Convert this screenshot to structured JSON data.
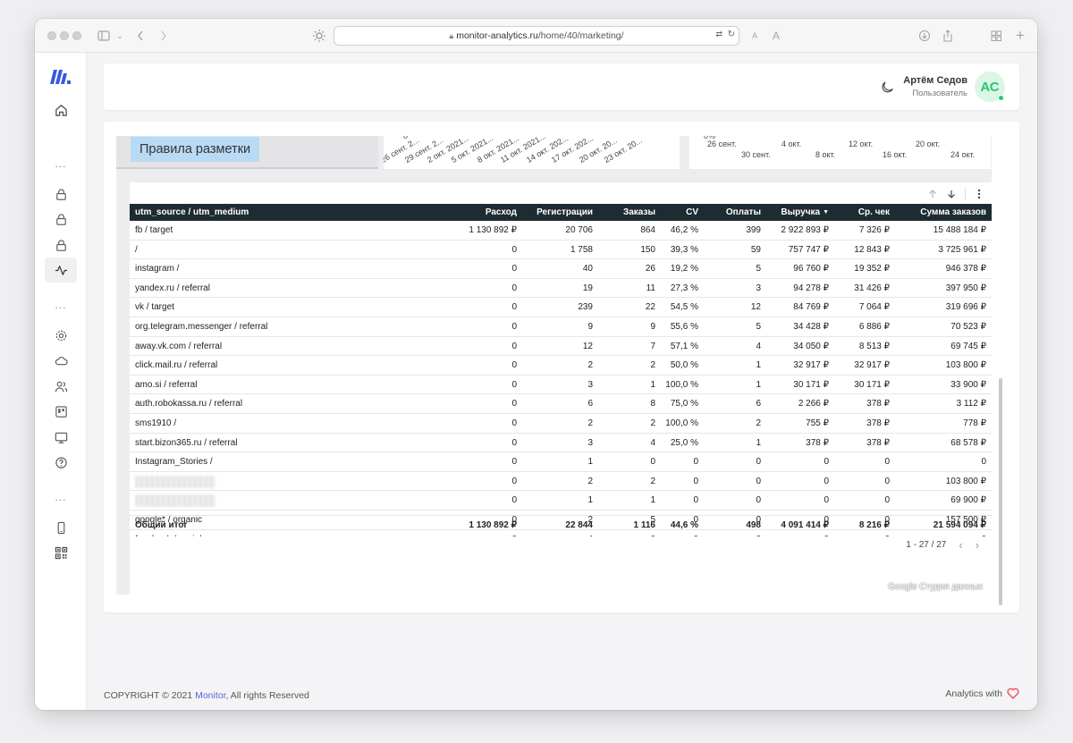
{
  "browser": {
    "url_host": "monitor-analytics.ru",
    "url_path": "/home/40/marketing/",
    "text_size_small": "A",
    "text_size_large": "A"
  },
  "sidebar": {
    "logo": "monitor-logo",
    "items": [
      {
        "icon": "home-icon"
      },
      {
        "icon": "lock-icon"
      },
      {
        "icon": "lock-icon"
      },
      {
        "icon": "lock-icon"
      },
      {
        "icon": "activity-icon",
        "active": true
      },
      {
        "icon": "gear-icon"
      },
      {
        "icon": "cloud-icon"
      },
      {
        "icon": "users-icon"
      },
      {
        "icon": "board-icon"
      },
      {
        "icon": "monitor-icon"
      },
      {
        "icon": "help-icon"
      },
      {
        "icon": "phone-icon"
      },
      {
        "icon": "qr-icon"
      }
    ],
    "dots": "..."
  },
  "header": {
    "user_name": "Артём Седов",
    "user_role": "Пользователь",
    "avatar_initials": "АС",
    "avatar_color": "#28c76f"
  },
  "report": {
    "rules_label": "Правила разметки",
    "chart1_ticks": [
      "26 сент. 2...",
      "29 сент. 2...",
      "2 окт. 2021...",
      "5 окт. 2021...",
      "8 окт. 2021...",
      "11 окт. 2021...",
      "14 окт. 202...",
      "17 окт. 202...",
      "20 окт. 20...",
      "23 окт. 20..."
    ],
    "chart1_zero": "0",
    "chart2_pct": "0%",
    "chart2_ticks_top": [
      "26 сент.",
      "4 окт.",
      "12 окт.",
      "20 окт."
    ],
    "chart2_ticks_bottom": [
      "30 сент.",
      "8 окт.",
      "16 окт.",
      "24 окт."
    ],
    "watermark": "Google Студия данных"
  },
  "table": {
    "columns": [
      "utm_source / utm_medium",
      "Расход",
      "Регистрации",
      "Заказы",
      "CV",
      "Оплаты",
      "Выручка",
      "Ср. чек",
      "Сумма заказов"
    ],
    "sort_indicator": "▼",
    "rows": [
      [
        "fb / target",
        "1 130 892 ₽",
        "20 706",
        "864",
        "46,2 %",
        "399",
        "2 922 893 ₽",
        "7 326 ₽",
        "15 488 184 ₽"
      ],
      [
        "/",
        "0",
        "1 758",
        "150",
        "39,3 %",
        "59",
        "757 747 ₽",
        "12 843 ₽",
        "3 725 961 ₽"
      ],
      [
        "instagram /",
        "0",
        "40",
        "26",
        "19,2 %",
        "5",
        "96 760 ₽",
        "19 352 ₽",
        "946 378 ₽"
      ],
      [
        "yandex.ru / referral",
        "0",
        "19",
        "11",
        "27,3 %",
        "3",
        "94 278 ₽",
        "31 426 ₽",
        "397 950 ₽"
      ],
      [
        "vk / target",
        "0",
        "239",
        "22",
        "54,5 %",
        "12",
        "84 769 ₽",
        "7 064 ₽",
        "319 696 ₽"
      ],
      [
        "org.telegram.messenger / referral",
        "0",
        "9",
        "9",
        "55,6 %",
        "5",
        "34 428 ₽",
        "6 886 ₽",
        "70 523 ₽"
      ],
      [
        "away.vk.com / referral",
        "0",
        "12",
        "7",
        "57,1 %",
        "4",
        "34 050 ₽",
        "8 513 ₽",
        "69 745 ₽"
      ],
      [
        "click.mail.ru / referral",
        "0",
        "2",
        "2",
        "50,0 %",
        "1",
        "32 917 ₽",
        "32 917 ₽",
        "103 800 ₽"
      ],
      [
        "amo.si / referral",
        "0",
        "3",
        "1",
        "100,0 %",
        "1",
        "30 171 ₽",
        "30 171 ₽",
        "33 900 ₽"
      ],
      [
        "auth.robokassa.ru / referral",
        "0",
        "6",
        "8",
        "75,0 %",
        "6",
        "2 266 ₽",
        "378 ₽",
        "3 112 ₽"
      ],
      [
        "sms1910 /",
        "0",
        "2",
        "2",
        "100,0 %",
        "2",
        "755 ₽",
        "378 ₽",
        "778 ₽"
      ],
      [
        "start.bizon365.ru / referral",
        "0",
        "3",
        "4",
        "25,0 %",
        "1",
        "378 ₽",
        "378 ₽",
        "68 578 ₽"
      ],
      [
        "Instagram_Stories /",
        "0",
        "1",
        "0",
        "0",
        "0",
        "0",
        "0",
        "0"
      ],
      [
        "",
        "0",
        "2",
        "2",
        "0",
        "0",
        "0",
        "0",
        "103 800 ₽"
      ],
      [
        "l",
        "0",
        "1",
        "1",
        "0",
        "0",
        "0",
        "0",
        "69 900 ₽"
      ],
      [
        "google* / organic",
        "0",
        "2",
        "5",
        "0",
        "0",
        "0",
        "0",
        "157 500 ₽"
      ],
      [
        "facebook / social",
        "0",
        "4",
        "0",
        "0",
        "0",
        "0",
        "0",
        "0"
      ]
    ],
    "total": [
      "Общий итог",
      "1 130 892 ₽",
      "22 844",
      "1 116",
      "44,6 %",
      "498",
      "4 091 414 ₽",
      "8 216 ₽",
      "21 594 094 ₽"
    ],
    "pagination": "1 - 27 / 27"
  },
  "footer": {
    "copyright_prefix": "COPYRIGHT © 2021 ",
    "brand": "Monitor",
    "copyright_suffix": ", All rights Reserved",
    "analytics_with": "Analytics with",
    "heart_color": "#ea5455"
  }
}
